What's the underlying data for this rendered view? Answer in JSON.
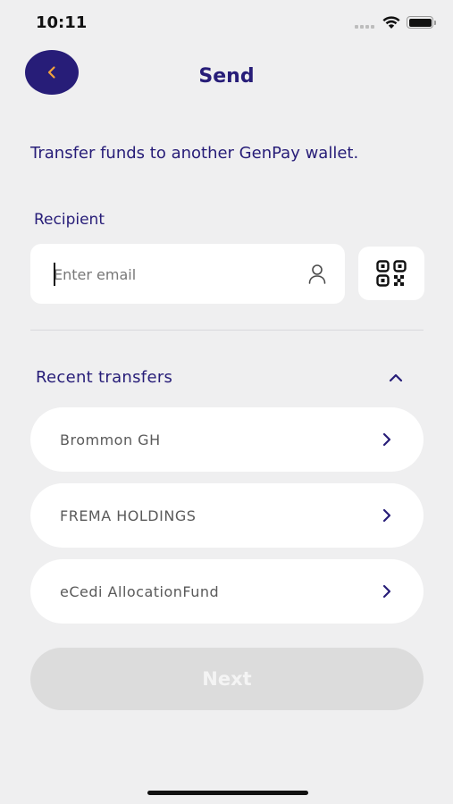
{
  "status_bar": {
    "time": "10:11"
  },
  "header": {
    "title": "Send",
    "back_icon": "chevron-left-icon"
  },
  "subtitle": "Transfer funds to another GenPay wallet.",
  "recipient": {
    "label": "Recipient",
    "placeholder": "Enter email",
    "value": "",
    "field_icon": "person-icon",
    "qr_icon": "qr-code-icon"
  },
  "recent_transfers": {
    "title": "Recent transfers",
    "toggle_icon": "chevron-up-icon",
    "items": [
      {
        "label": "Brommon GH"
      },
      {
        "label": "FREMA HOLDINGS"
      },
      {
        "label": "eCedi AllocationFund"
      }
    ]
  },
  "next_button": {
    "label": "Next",
    "enabled": false
  },
  "colors": {
    "brand": "#271d78",
    "accent": "#f2a33c",
    "background": "#efeff0",
    "disabled_button": "#dcdcdc"
  }
}
